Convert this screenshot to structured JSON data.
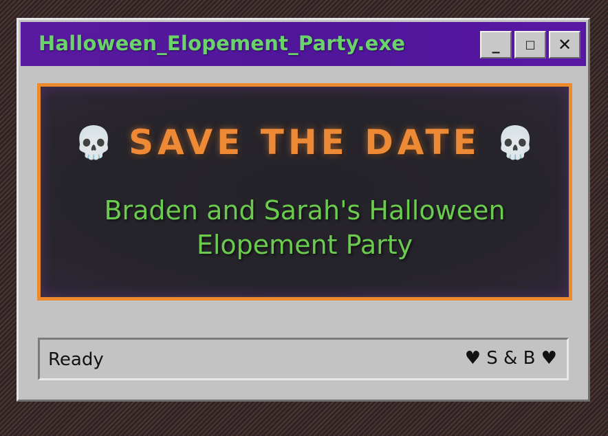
{
  "window": {
    "title": "Halloween_Elopement_Party.exe",
    "controls": {
      "minimize_label": "_",
      "maximize_label": "□",
      "close_label": "✕"
    }
  },
  "banner": {
    "left_icon": "💀",
    "left_icon_name": "skull-icon",
    "headline": "SAVE THE DATE",
    "right_icon": "💀",
    "right_icon_name": "skull-icon",
    "subtitle_line1": "Braden and Sarah's Halloween",
    "subtitle_line2": "Elopement Party"
  },
  "statusbar": {
    "status": "Ready",
    "signature": "♥ S & B ♥"
  },
  "colors": {
    "titlebar": "#5a1aa0",
    "title_text": "#6bd36b",
    "banner_border": "#ee8a2c",
    "headline": "#ee8a35",
    "subtitle": "#6acb4e",
    "window_face": "#c3c3c3"
  }
}
